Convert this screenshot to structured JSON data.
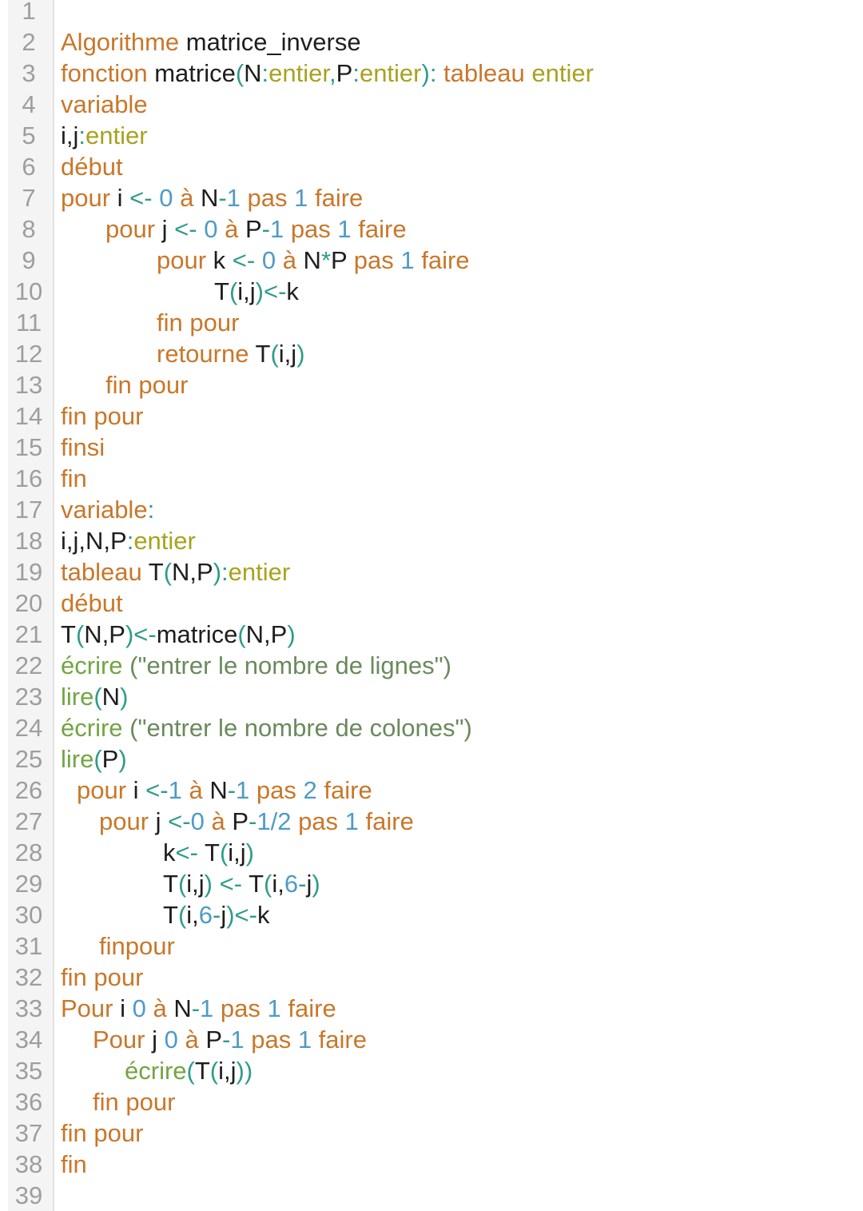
{
  "editor": {
    "gutter_color": "#f4f4f4",
    "token_colors": {
      "keyword": "#c9772a",
      "type": "#a8a21f",
      "function": "#72a542",
      "operator": "#2e9c8c",
      "number": "#4d9bc7",
      "string": "#6a8a5c",
      "identifier": "#1e1e1e"
    },
    "lines": [
      {
        "number": "1",
        "indent": 0,
        "tokens": []
      },
      {
        "number": "2",
        "indent": 0,
        "tokens": [
          {
            "t": "kw",
            "v": "Algorithme"
          },
          {
            "t": "id",
            "v": " matrice_inverse"
          }
        ]
      },
      {
        "number": "3",
        "indent": 0,
        "tokens": [
          {
            "t": "kw",
            "v": "fonction"
          },
          {
            "t": "id",
            "v": " matrice"
          },
          {
            "t": "op",
            "v": "("
          },
          {
            "t": "id",
            "v": "N"
          },
          {
            "t": "op",
            "v": ":"
          },
          {
            "t": "ty",
            "v": "entier"
          },
          {
            "t": "op",
            "v": ","
          },
          {
            "t": "id",
            "v": "P"
          },
          {
            "t": "op",
            "v": ":"
          },
          {
            "t": "ty",
            "v": "entier"
          },
          {
            "t": "op",
            "v": "):"
          },
          {
            "t": "kw",
            "v": " tableau"
          },
          {
            "t": "ty",
            "v": " entier"
          }
        ]
      },
      {
        "number": "4",
        "indent": 0,
        "tokens": [
          {
            "t": "kw",
            "v": "variable"
          }
        ]
      },
      {
        "number": "5",
        "indent": 0,
        "tokens": [
          {
            "t": "id",
            "v": "i,j"
          },
          {
            "t": "op",
            "v": ":"
          },
          {
            "t": "ty",
            "v": "entier"
          }
        ]
      },
      {
        "number": "6",
        "indent": 0,
        "tokens": [
          {
            "t": "kw",
            "v": "début"
          }
        ]
      },
      {
        "number": "7",
        "indent": 0,
        "tokens": [
          {
            "t": "kw",
            "v": "pour"
          },
          {
            "t": "id",
            "v": " i "
          },
          {
            "t": "op",
            "v": "<-"
          },
          {
            "t": "num",
            "v": " 0"
          },
          {
            "t": "kw",
            "v": " à"
          },
          {
            "t": "id",
            "v": " N"
          },
          {
            "t": "op",
            "v": "-"
          },
          {
            "t": "num",
            "v": "1"
          },
          {
            "t": "kw",
            "v": " pas"
          },
          {
            "t": "num",
            "v": " 1"
          },
          {
            "t": "kw",
            "v": " faire"
          }
        ]
      },
      {
        "number": "8",
        "indent": 56,
        "tokens": [
          {
            "t": "kw",
            "v": "pour"
          },
          {
            "t": "id",
            "v": " j "
          },
          {
            "t": "op",
            "v": "<-"
          },
          {
            "t": "num",
            "v": " 0"
          },
          {
            "t": "kw",
            "v": " à"
          },
          {
            "t": "id",
            "v": " P"
          },
          {
            "t": "op",
            "v": "-"
          },
          {
            "t": "num",
            "v": "1"
          },
          {
            "t": "kw",
            "v": " pas"
          },
          {
            "t": "num",
            "v": " 1"
          },
          {
            "t": "kw",
            "v": " faire"
          }
        ]
      },
      {
        "number": "9",
        "indent": 120,
        "tokens": [
          {
            "t": "kw",
            "v": "pour"
          },
          {
            "t": "id",
            "v": " k "
          },
          {
            "t": "op",
            "v": "<-"
          },
          {
            "t": "num",
            "v": " 0"
          },
          {
            "t": "kw",
            "v": " à"
          },
          {
            "t": "id",
            "v": " N"
          },
          {
            "t": "op",
            "v": "*"
          },
          {
            "t": "id",
            "v": "P"
          },
          {
            "t": "kw",
            "v": " pas"
          },
          {
            "t": "num",
            "v": " 1"
          },
          {
            "t": "kw",
            "v": " faire"
          }
        ]
      },
      {
        "number": "10",
        "indent": 192,
        "tokens": [
          {
            "t": "id",
            "v": "T"
          },
          {
            "t": "op",
            "v": "("
          },
          {
            "t": "id",
            "v": "i,j"
          },
          {
            "t": "op",
            "v": ")<-"
          },
          {
            "t": "id",
            "v": "k"
          }
        ]
      },
      {
        "number": "11",
        "indent": 120,
        "tokens": [
          {
            "t": "kw",
            "v": "fin pour"
          }
        ]
      },
      {
        "number": "12",
        "indent": 120,
        "tokens": [
          {
            "t": "kw",
            "v": "retourne"
          },
          {
            "t": "id",
            "v": " T"
          },
          {
            "t": "op",
            "v": "("
          },
          {
            "t": "id",
            "v": "i,j"
          },
          {
            "t": "op",
            "v": ")"
          }
        ]
      },
      {
        "number": "13",
        "indent": 56,
        "tokens": [
          {
            "t": "kw",
            "v": "fin pour"
          }
        ]
      },
      {
        "number": "14",
        "indent": 0,
        "tokens": [
          {
            "t": "kw",
            "v": "fin pour"
          }
        ]
      },
      {
        "number": "15",
        "indent": 0,
        "tokens": [
          {
            "t": "kw",
            "v": "finsi"
          }
        ]
      },
      {
        "number": "16",
        "indent": 0,
        "tokens": [
          {
            "t": "kw",
            "v": "fin"
          }
        ]
      },
      {
        "number": "17",
        "indent": 0,
        "tokens": [
          {
            "t": "kw",
            "v": "variable"
          },
          {
            "t": "op",
            "v": ":"
          }
        ]
      },
      {
        "number": "18",
        "indent": 0,
        "tokens": [
          {
            "t": "id",
            "v": "i,j,N,P"
          },
          {
            "t": "op",
            "v": ":"
          },
          {
            "t": "ty",
            "v": "entier"
          }
        ]
      },
      {
        "number": "19",
        "indent": 0,
        "tokens": [
          {
            "t": "kw",
            "v": "tableau"
          },
          {
            "t": "id",
            "v": " T"
          },
          {
            "t": "op",
            "v": "("
          },
          {
            "t": "id",
            "v": "N,P"
          },
          {
            "t": "op",
            "v": "):"
          },
          {
            "t": "ty",
            "v": "entier"
          }
        ]
      },
      {
        "number": "20",
        "indent": 0,
        "tokens": [
          {
            "t": "kw",
            "v": "début"
          }
        ]
      },
      {
        "number": "21",
        "indent": 0,
        "tokens": [
          {
            "t": "id",
            "v": "T"
          },
          {
            "t": "op",
            "v": "("
          },
          {
            "t": "id",
            "v": "N,P"
          },
          {
            "t": "op",
            "v": ")<-"
          },
          {
            "t": "id",
            "v": "matrice"
          },
          {
            "t": "op",
            "v": "("
          },
          {
            "t": "id",
            "v": "N,P"
          },
          {
            "t": "op",
            "v": ")"
          }
        ]
      },
      {
        "number": "22",
        "indent": 0,
        "tokens": [
          {
            "t": "fn",
            "v": "écrire"
          },
          {
            "t": "str",
            "v": " (\"entrer le nombre de lignes\")"
          }
        ]
      },
      {
        "number": "23",
        "indent": 0,
        "tokens": [
          {
            "t": "fn",
            "v": "lire"
          },
          {
            "t": "op",
            "v": "("
          },
          {
            "t": "id",
            "v": "N"
          },
          {
            "t": "op",
            "v": ")"
          }
        ]
      },
      {
        "number": "24",
        "indent": 0,
        "tokens": [
          {
            "t": "fn",
            "v": "écrire"
          },
          {
            "t": "str",
            "v": " (\"entrer le nombre de colones\")"
          }
        ]
      },
      {
        "number": "25",
        "indent": 0,
        "tokens": [
          {
            "t": "fn",
            "v": "lire"
          },
          {
            "t": "op",
            "v": "("
          },
          {
            "t": "id",
            "v": "P"
          },
          {
            "t": "op",
            "v": ")"
          }
        ]
      },
      {
        "number": "26",
        "indent": 20,
        "tokens": [
          {
            "t": "kw",
            "v": "pour"
          },
          {
            "t": "id",
            "v": " i "
          },
          {
            "t": "op",
            "v": "<-"
          },
          {
            "t": "num",
            "v": "1"
          },
          {
            "t": "kw",
            "v": " à"
          },
          {
            "t": "id",
            "v": " N"
          },
          {
            "t": "op",
            "v": "-"
          },
          {
            "t": "num",
            "v": "1"
          },
          {
            "t": "kw",
            "v": " pas"
          },
          {
            "t": "num",
            "v": " 2"
          },
          {
            "t": "kw",
            "v": " faire"
          }
        ]
      },
      {
        "number": "27",
        "indent": 48,
        "tokens": [
          {
            "t": "kw",
            "v": "pour"
          },
          {
            "t": "id",
            "v": " j "
          },
          {
            "t": "op",
            "v": "<-"
          },
          {
            "t": "num",
            "v": "0"
          },
          {
            "t": "kw",
            "v": " à"
          },
          {
            "t": "id",
            "v": " P"
          },
          {
            "t": "op",
            "v": "-"
          },
          {
            "t": "num",
            "v": "1/2"
          },
          {
            "t": "kw",
            "v": " pas"
          },
          {
            "t": "num",
            "v": " 1"
          },
          {
            "t": "kw",
            "v": " faire"
          }
        ]
      },
      {
        "number": "28",
        "indent": 128,
        "tokens": [
          {
            "t": "id",
            "v": "k"
          },
          {
            "t": "op",
            "v": "<-"
          },
          {
            "t": "id",
            "v": " T"
          },
          {
            "t": "op",
            "v": "("
          },
          {
            "t": "id",
            "v": "i,j"
          },
          {
            "t": "op",
            "v": ")"
          }
        ]
      },
      {
        "number": "29",
        "indent": 128,
        "tokens": [
          {
            "t": "id",
            "v": "T"
          },
          {
            "t": "op",
            "v": "("
          },
          {
            "t": "id",
            "v": "i,j"
          },
          {
            "t": "op",
            "v": ") <-"
          },
          {
            "t": "id",
            "v": " T"
          },
          {
            "t": "op",
            "v": "("
          },
          {
            "t": "id",
            "v": "i,"
          },
          {
            "t": "num",
            "v": "6"
          },
          {
            "t": "op",
            "v": "-"
          },
          {
            "t": "id",
            "v": "j"
          },
          {
            "t": "op",
            "v": ")"
          }
        ]
      },
      {
        "number": "30",
        "indent": 128,
        "tokens": [
          {
            "t": "id",
            "v": "T"
          },
          {
            "t": "op",
            "v": "("
          },
          {
            "t": "id",
            "v": "i,"
          },
          {
            "t": "num",
            "v": "6"
          },
          {
            "t": "op",
            "v": "-"
          },
          {
            "t": "id",
            "v": "j"
          },
          {
            "t": "op",
            "v": ")<-"
          },
          {
            "t": "id",
            "v": "k"
          }
        ]
      },
      {
        "number": "31",
        "indent": 48,
        "tokens": [
          {
            "t": "kw",
            "v": "finpour"
          }
        ]
      },
      {
        "number": "32",
        "indent": 0,
        "tokens": [
          {
            "t": "kw",
            "v": "fin pour"
          }
        ]
      },
      {
        "number": "33",
        "indent": 0,
        "tokens": [
          {
            "t": "kw",
            "v": "Pour"
          },
          {
            "t": "id",
            "v": " i "
          },
          {
            "t": "num",
            "v": "0"
          },
          {
            "t": "kw",
            "v": " à"
          },
          {
            "t": "id",
            "v": " N"
          },
          {
            "t": "op",
            "v": "-"
          },
          {
            "t": "num",
            "v": "1"
          },
          {
            "t": "kw",
            "v": " pas"
          },
          {
            "t": "num",
            "v": " 1"
          },
          {
            "t": "kw",
            "v": " faire"
          }
        ]
      },
      {
        "number": "34",
        "indent": 40,
        "tokens": [
          {
            "t": "kw",
            "v": "Pour"
          },
          {
            "t": "id",
            "v": " j "
          },
          {
            "t": "num",
            "v": "0"
          },
          {
            "t": "kw",
            "v": " à"
          },
          {
            "t": "id",
            "v": " P"
          },
          {
            "t": "op",
            "v": "-"
          },
          {
            "t": "num",
            "v": "1"
          },
          {
            "t": "kw",
            "v": " pas"
          },
          {
            "t": "num",
            "v": " 1"
          },
          {
            "t": "kw",
            "v": " faire"
          }
        ]
      },
      {
        "number": "35",
        "indent": 80,
        "tokens": [
          {
            "t": "fn",
            "v": "écrire"
          },
          {
            "t": "op",
            "v": "("
          },
          {
            "t": "id",
            "v": "T"
          },
          {
            "t": "op",
            "v": "("
          },
          {
            "t": "id",
            "v": "i,j"
          },
          {
            "t": "op",
            "v": "))"
          }
        ]
      },
      {
        "number": "36",
        "indent": 40,
        "tokens": [
          {
            "t": "kw",
            "v": "fin pour"
          }
        ]
      },
      {
        "number": "37",
        "indent": 0,
        "tokens": [
          {
            "t": "kw",
            "v": "fin pour"
          }
        ]
      },
      {
        "number": "38",
        "indent": 0,
        "tokens": [
          {
            "t": "kw",
            "v": "fin"
          }
        ]
      },
      {
        "number": "39",
        "indent": 0,
        "tokens": []
      }
    ]
  }
}
